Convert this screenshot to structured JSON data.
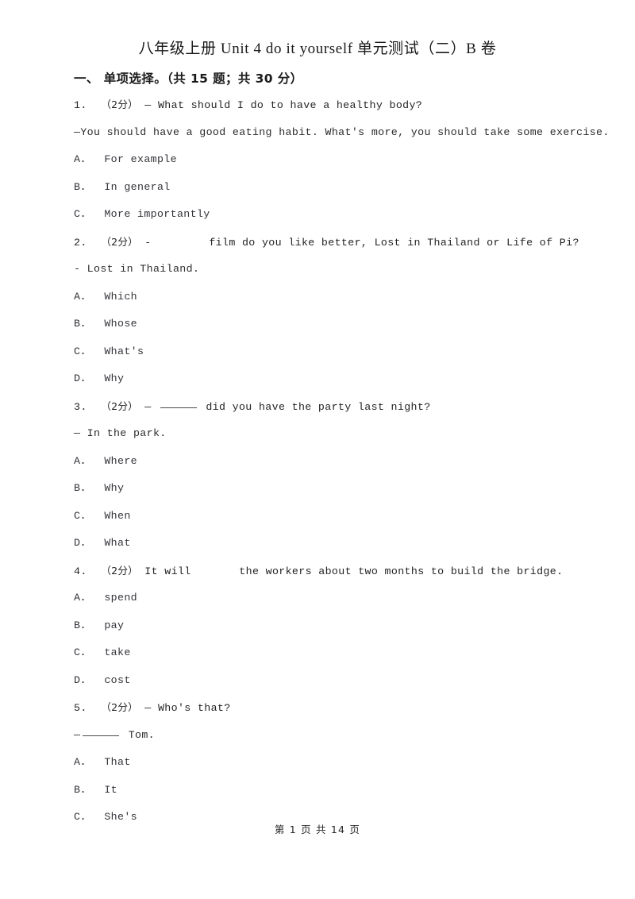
{
  "document": {
    "title": "八年级上册 Unit 4 do it yourself 单元测试（二）B 卷",
    "footer": "第 1 页 共 14 页"
  },
  "section": {
    "label": "一、 单项选择。（共 15 题；共 30 分）"
  },
  "questions": [
    {
      "number": "1.",
      "points": "（2分）",
      "stem_before": "— What should I do to have a healthy body?",
      "stem_gap": "none",
      "stem_after": "",
      "answer": "—You should have a good eating habit. What's more, you should take some exercise.",
      "options": [
        {
          "letter": "A．",
          "text": "For example"
        },
        {
          "letter": "B．",
          "text": "In general"
        },
        {
          "letter": "C．",
          "text": "More importantly"
        }
      ]
    },
    {
      "number": "2.",
      "points": "（2分）",
      "stem_before": "-",
      "stem_gap": "space",
      "stem_after": "film do you like better, Lost in Thailand or Life of Pi?",
      "answer": "- Lost in Thailand.",
      "options": [
        {
          "letter": "A．",
          "text": "Which"
        },
        {
          "letter": "B．",
          "text": "Whose"
        },
        {
          "letter": "C．",
          "text": "What's"
        },
        {
          "letter": "D．",
          "text": "Why"
        }
      ]
    },
    {
      "number": "3.",
      "points": "（2分）",
      "stem_before": "—",
      "stem_gap": "underline",
      "stem_after": "did you have the party last night?",
      "answer": "— In the park.",
      "options": [
        {
          "letter": "A．",
          "text": "Where"
        },
        {
          "letter": "B．",
          "text": "Why"
        },
        {
          "letter": "C．",
          "text": "When"
        },
        {
          "letter": "D．",
          "text": "What"
        }
      ]
    },
    {
      "number": "4.",
      "points": "（2分）",
      "stem_before": "It will",
      "stem_gap": "space",
      "stem_after": "the workers about two months to build the bridge.",
      "answer": "",
      "options": [
        {
          "letter": "A．",
          "text": "spend"
        },
        {
          "letter": "B．",
          "text": "pay"
        },
        {
          "letter": "C．",
          "text": "take"
        },
        {
          "letter": "D．",
          "text": "cost"
        }
      ]
    },
    {
      "number": "5.",
      "points": "（2分）",
      "stem_before": "— Who's that?",
      "stem_gap": "none",
      "stem_after": "",
      "answer_prefix": "—",
      "answer_gap": "underline",
      "answer_suffix": "Tom.",
      "answer": "",
      "options": [
        {
          "letter": "A．",
          "text": "That"
        },
        {
          "letter": "B．",
          "text": "It"
        },
        {
          "letter": "C．",
          "text": "She's"
        }
      ]
    }
  ]
}
